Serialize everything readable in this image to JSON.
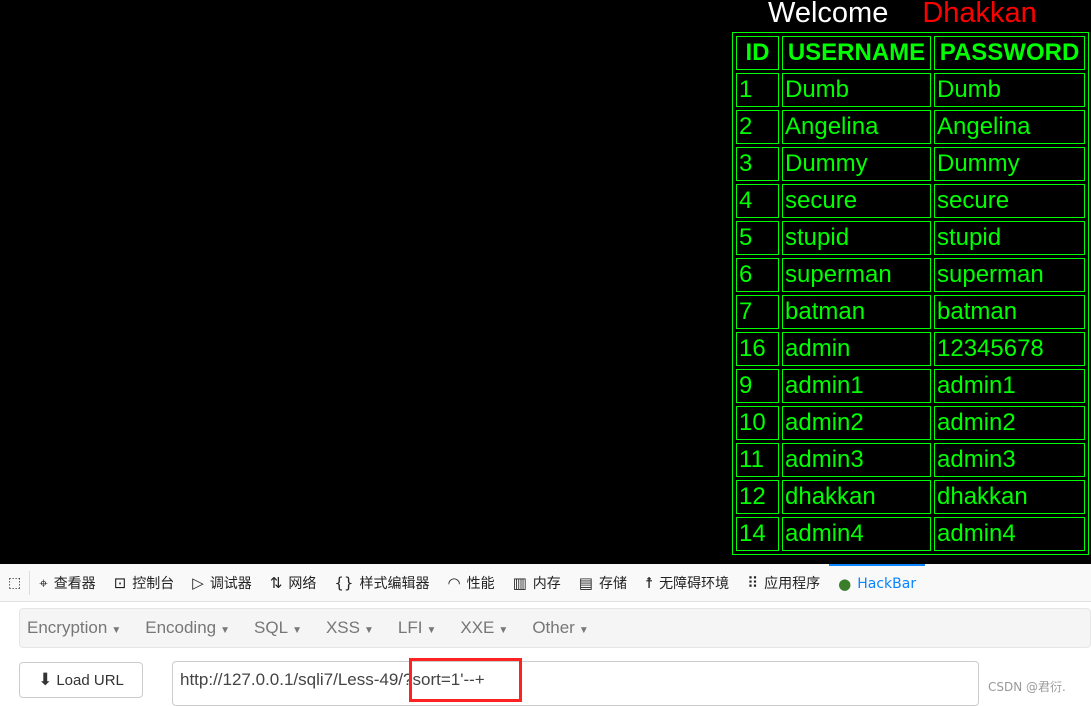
{
  "page": {
    "welcome": "Welcome",
    "user": "Dhakkan",
    "headers": [
      "ID",
      "USERNAME",
      "PASSWORD"
    ],
    "rows": [
      [
        "1",
        "Dumb",
        "Dumb"
      ],
      [
        "2",
        "Angelina",
        "Angelina"
      ],
      [
        "3",
        "Dummy",
        "Dummy"
      ],
      [
        "4",
        "secure",
        "secure"
      ],
      [
        "5",
        "stupid",
        "stupid"
      ],
      [
        "6",
        "superman",
        "superman"
      ],
      [
        "7",
        "batman",
        "batman"
      ],
      [
        "16",
        "admin",
        "12345678"
      ],
      [
        "9",
        "admin1",
        "admin1"
      ],
      [
        "10",
        "admin2",
        "admin2"
      ],
      [
        "11",
        "admin3",
        "admin3"
      ],
      [
        "12",
        "dhakkan",
        "dhakkan"
      ],
      [
        "14",
        "admin4",
        "admin4"
      ]
    ],
    "colors": {
      "text": "#00ff00",
      "accent_name": "#ff0000"
    }
  },
  "devtools": {
    "tabs": [
      {
        "label": "查看器",
        "icon": "inspector-icon"
      },
      {
        "label": "控制台",
        "icon": "console-icon"
      },
      {
        "label": "调试器",
        "icon": "debugger-icon"
      },
      {
        "label": "网络",
        "icon": "network-icon"
      },
      {
        "label": "样式编辑器",
        "icon": "style-editor-icon"
      },
      {
        "label": "性能",
        "icon": "performance-icon"
      },
      {
        "label": "内存",
        "icon": "memory-icon"
      },
      {
        "label": "存储",
        "icon": "storage-icon"
      },
      {
        "label": "无障碍环境",
        "icon": "accessibility-icon"
      },
      {
        "label": "应用程序",
        "icon": "application-icon"
      },
      {
        "label": "HackBar",
        "icon": "hackbar-icon",
        "active": true
      }
    ]
  },
  "hackbar": {
    "menu": [
      "Encryption",
      "Encoding",
      "SQL",
      "XSS",
      "LFI",
      "XXE",
      "Other"
    ],
    "load_url": "Load URL",
    "url": "http://127.0.0.1/sqli7/Less-49/?sort=1'--+"
  },
  "watermark": "CSDN @君衍."
}
